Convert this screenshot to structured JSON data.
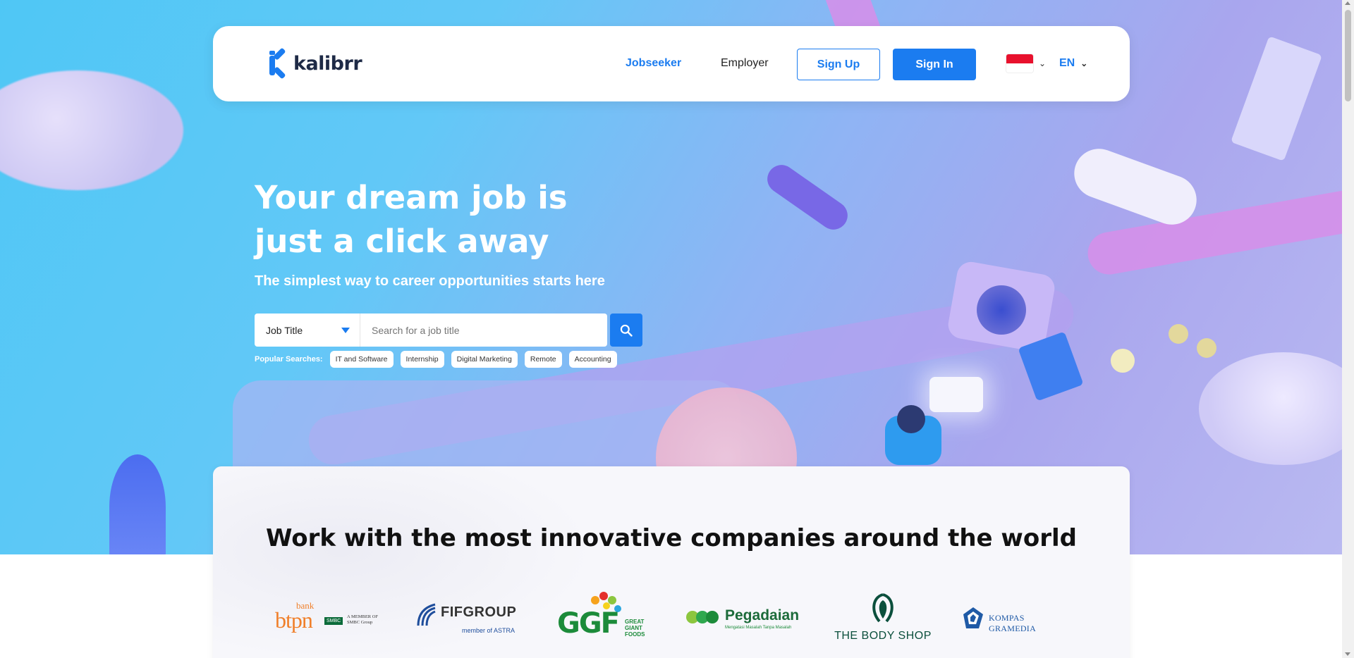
{
  "brand": {
    "name": "kalibrr",
    "accent": "#1b7cf0"
  },
  "nav": {
    "jobseeker": "Jobseeker",
    "employer": "Employer",
    "sign_up": "Sign Up",
    "sign_in": "Sign In",
    "country_flag": "indonesia-flag",
    "language": "EN"
  },
  "hero": {
    "title_line1": "Your dream job is",
    "title_line2": "just a click away",
    "subtitle": "The simplest way to career opportunities starts here"
  },
  "search": {
    "type_selected": "Job Title",
    "placeholder": "Search for a job title",
    "button_icon": "search-icon"
  },
  "popular": {
    "label": "Popular Searches:",
    "items": [
      "IT and Software",
      "Internship",
      "Digital Marketing",
      "Remote",
      "Accounting"
    ]
  },
  "companies": {
    "title": "Work with the most innovative companies around the world",
    "logos": [
      {
        "name": "btpn",
        "top": "bank",
        "tag1": "SMBC",
        "tag2": "A MEMBER OF",
        "tag3": "SMBC Group"
      },
      {
        "name": "FIFGROUP",
        "sub": "member of ASTRA"
      },
      {
        "name": "GGF",
        "sub1": "GREAT",
        "sub2": "GIANT",
        "sub3": "FOODS"
      },
      {
        "name": "Pegadaian",
        "sub": "Mengatasi Masalah Tanpa Masalah"
      },
      {
        "name": "THE BODY SHOP"
      },
      {
        "name": "KOMPAS GRAMEDIA"
      }
    ]
  }
}
